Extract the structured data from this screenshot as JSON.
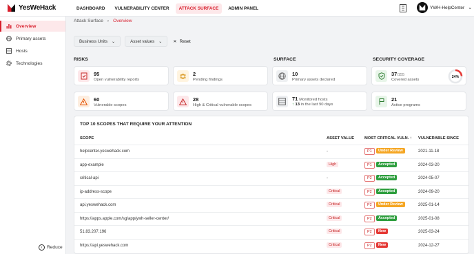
{
  "brand": {
    "name": "YesWeHack"
  },
  "nav": {
    "items": [
      {
        "label": "DASHBOARD",
        "active": false
      },
      {
        "label": "VULNERABILITY CENTER",
        "active": false
      },
      {
        "label": "ATTACK SURFACE",
        "active": true
      },
      {
        "label": "ADMIN PANEL",
        "active": false
      }
    ],
    "account": "YWH-HelpCenter"
  },
  "sidebar": {
    "items": [
      {
        "label": "Overview",
        "icon": "chart-icon",
        "active": true
      },
      {
        "label": "Primary assets",
        "icon": "globe-icon",
        "active": false
      },
      {
        "label": "Hosts",
        "icon": "server-icon",
        "active": false
      },
      {
        "label": "Technologies",
        "icon": "gear-icon",
        "active": false
      }
    ],
    "reduce_label": "Reduce"
  },
  "breadcrumb": {
    "parent": "Attack Surface",
    "current": "Overview"
  },
  "filters": {
    "business_units": "Business Units",
    "asset_values": "Asset values",
    "reset": "Reset"
  },
  "sections": {
    "risks": "RISKS",
    "surface": "SURFACE",
    "coverage": "SECURITY COVERAGE"
  },
  "risks": [
    {
      "value": "95",
      "label": "Open vulnerability reports",
      "icon": "report-icon",
      "color": "#c62828"
    },
    {
      "value": "2",
      "label": "Pending findings",
      "icon": "bug-icon",
      "color": "#f5a623"
    },
    {
      "value": "60",
      "label": "Vulnerable scopes",
      "icon": "warning-icon",
      "color": "#e65100"
    },
    {
      "value": "28",
      "label": "High & Critical vulnerable scopes",
      "icon": "warning-icon",
      "color": "#c62828"
    }
  ],
  "surface": {
    "primary": {
      "value": "10",
      "label": "Primary assets declared",
      "icon": "globe-icon"
    },
    "hosts": {
      "value": "71",
      "label": "Monitored hosts",
      "recent_value": "13",
      "recent_label": "in the last 90 days",
      "icon": "server-icon"
    }
  },
  "coverage": {
    "assets": {
      "value": "37",
      "total": "/155",
      "label": "Covered assets",
      "percent": "24%",
      "fraction": 0.24,
      "icon": "shield-icon"
    },
    "programs": {
      "value": "21",
      "label": "Active programs",
      "icon": "flag-icon"
    }
  },
  "table": {
    "title": "TOP 10 SCOPES THAT REQUIRE YOUR ATTENTION",
    "headers": {
      "scope": "SCOPE",
      "asset_value": "ASSET VALUE",
      "critical": "MOST CRITICAL VULN.",
      "since": "VULNERABLE SINCE"
    },
    "rows": [
      {
        "scope": "helpcenter.yeswehack.com",
        "asset": "-",
        "priority": "P1",
        "status": "Under Review",
        "since": "2021-11-18"
      },
      {
        "scope": "app-example",
        "asset": "High",
        "priority": "P1",
        "status": "Accepted",
        "since": "2024-03-20"
      },
      {
        "scope": "critical-api",
        "asset": "-",
        "priority": "P2",
        "status": "Accepted",
        "since": "2024-05-07"
      },
      {
        "scope": "ip-address-scope",
        "asset": "Critical",
        "priority": "P2",
        "status": "Accepted",
        "since": "2024-09-20"
      },
      {
        "scope": "api.yeswehack.com",
        "asset": "Critical",
        "priority": "P2",
        "status": "Under Review",
        "since": "2025-01-14"
      },
      {
        "scope": "https://apps.apple.com/sg/app/ywh-seller-center/",
        "asset": "Critical",
        "priority": "P2",
        "status": "Accepted",
        "since": "2025-01-08"
      },
      {
        "scope": "51.83.207.196",
        "asset": "Critical",
        "priority": "P2",
        "status": "New",
        "since": "2025-03-24"
      },
      {
        "scope": "https://api.yeswehack.com",
        "asset": "Critical",
        "priority": "P2",
        "status": "New",
        "since": "2024-12-27"
      }
    ]
  },
  "status_colors": {
    "Under Review": "#f5a623",
    "Accepted": "#2e9e3e",
    "New": "#e53935"
  },
  "accent": "#d81e2c"
}
